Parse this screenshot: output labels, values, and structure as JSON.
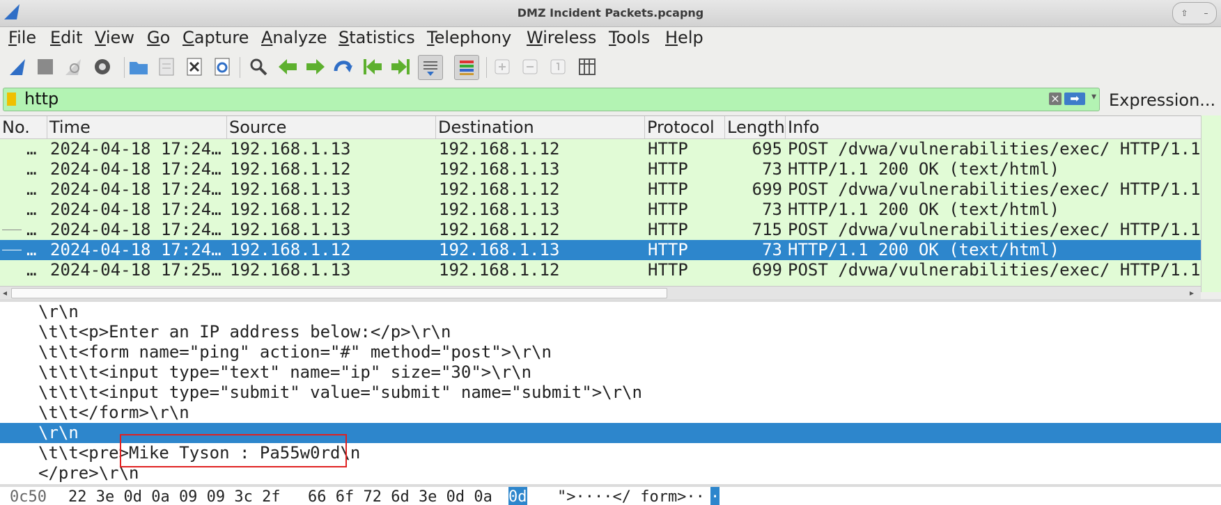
{
  "window": {
    "title": "DMZ Incident Packets.pcapng"
  },
  "menu": [
    {
      "label": "File"
    },
    {
      "label": "Edit"
    },
    {
      "label": "View"
    },
    {
      "label": "Go"
    },
    {
      "label": "Capture"
    },
    {
      "label": "Analyze"
    },
    {
      "label": "Statistics"
    },
    {
      "label": "Telephony"
    },
    {
      "label": "Wireless"
    },
    {
      "label": "Tools"
    },
    {
      "label": "Help"
    }
  ],
  "toolbar_icons": [
    "shark-fin-start-icon",
    "stop-capture-icon",
    "restart-capture-icon",
    "capture-options-icon",
    "open-file-icon",
    "save-file-icon",
    "close-file-icon",
    "reload-file-icon",
    "find-packet-icon",
    "go-back-icon",
    "go-forward-icon",
    "go-to-packet-icon",
    "first-packet-icon",
    "last-packet-icon",
    "autoscroll-icon",
    "colorize-icon",
    "zoom-in-icon",
    "zoom-out-icon",
    "normal-size-icon",
    "resize-columns-icon"
  ],
  "filter": {
    "value": "http",
    "expression_label": "Expression..."
  },
  "packet_list": {
    "columns": [
      "No.",
      "Time",
      "Source",
      "Destination",
      "Protocol",
      "Length",
      "Info"
    ],
    "rows": [
      {
        "no": "…",
        "time": "2024-04-18 17:24…",
        "source": "192.168.1.13",
        "destination": "192.168.1.12",
        "protocol": "HTTP",
        "length": "695",
        "info": "POST /dvwa/vulnerabilities/exec/ HTTP/1.1"
      },
      {
        "no": "…",
        "time": "2024-04-18 17:24…",
        "source": "192.168.1.12",
        "destination": "192.168.1.13",
        "protocol": "HTTP",
        "length": "73",
        "info": "HTTP/1.1 200 OK  (text/html)"
      },
      {
        "no": "…",
        "time": "2024-04-18 17:24…",
        "source": "192.168.1.13",
        "destination": "192.168.1.12",
        "protocol": "HTTP",
        "length": "699",
        "info": "POST /dvwa/vulnerabilities/exec/ HTTP/1.1"
      },
      {
        "no": "…",
        "time": "2024-04-18 17:24…",
        "source": "192.168.1.12",
        "destination": "192.168.1.13",
        "protocol": "HTTP",
        "length": "73",
        "info": "HTTP/1.1 200 OK  (text/html)"
      },
      {
        "no": "…",
        "time": "2024-04-18 17:24…",
        "source": "192.168.1.13",
        "destination": "192.168.1.12",
        "protocol": "HTTP",
        "length": "715",
        "info": "POST /dvwa/vulnerabilities/exec/ HTTP/1.1"
      },
      {
        "no": "…",
        "time": "2024-04-18 17:24…",
        "source": "192.168.1.12",
        "destination": "192.168.1.13",
        "protocol": "HTTP",
        "length": "73",
        "info": "HTTP/1.1 200 OK  (text/html)",
        "selected": true
      },
      {
        "no": "…",
        "time": "2024-04-18 17:25…",
        "source": "192.168.1.13",
        "destination": "192.168.1.12",
        "protocol": "HTTP",
        "length": "699",
        "info": "POST /dvwa/vulnerabilities/exec/ HTTP/1.1"
      }
    ]
  },
  "details": {
    "lines": [
      "\\r\\n",
      "\\t\\t<p>Enter an IP address below:</p>\\r\\n",
      "\\t\\t<form name=\"ping\" action=\"#\" method=\"post\">\\r\\n",
      "\\t\\t\\t<input type=\"text\" name=\"ip\" size=\"30\">\\r\\n",
      "\\t\\t\\t<input type=\"submit\" value=\"submit\" name=\"submit\">\\r\\n",
      "\\t\\t</form>\\r\\n",
      "\\r\\n",
      "\\t\\t<pre>Mike Tyson : Pa55w0rd\\n",
      "</pre>\\r\\n"
    ],
    "selected_index": 6
  },
  "hex": {
    "offset": "0c50",
    "bytes_group1": "22 3e 0d 0a 09 09 3c 2f",
    "bytes_group2": "66 6f 72 6d 3e 0d 0a",
    "bytes_highlight": "0d",
    "ascii": "\">····</ form>··",
    "ascii_highlight": "·"
  },
  "colors": {
    "filter_valid": "#b3f3b3",
    "row_http": "#e1fbd6",
    "selection": "#2d86cc",
    "annotation_box": "#e02020"
  }
}
